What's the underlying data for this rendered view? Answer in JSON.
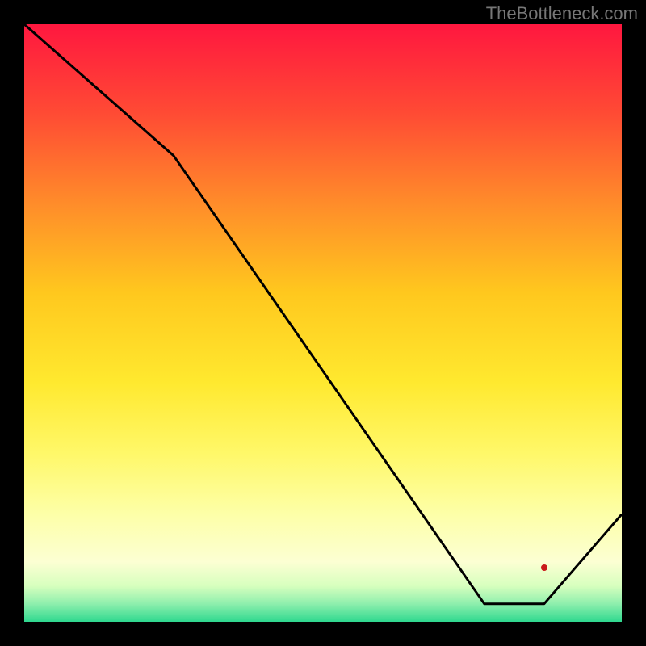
{
  "watermark": "TheBottleneck.com",
  "marker": {
    "label": "",
    "x_frac": 0.87,
    "y_frac": 0.91
  },
  "chart_data": {
    "type": "line",
    "title": "",
    "xlabel": "",
    "ylabel": "",
    "xlim": [
      0,
      100
    ],
    "ylim": [
      0,
      100
    ],
    "grid": false,
    "series": [
      {
        "name": "curve",
        "x": [
          0,
          25,
          77,
          87,
          100
        ],
        "y": [
          100,
          78,
          3,
          3,
          18
        ]
      }
    ],
    "annotations": [
      {
        "text": "",
        "x": 87,
        "y": 9,
        "color": "#c91a1a"
      }
    ],
    "background_gradient": {
      "top": "#ff173f",
      "bottom": "#2fd88f"
    }
  }
}
